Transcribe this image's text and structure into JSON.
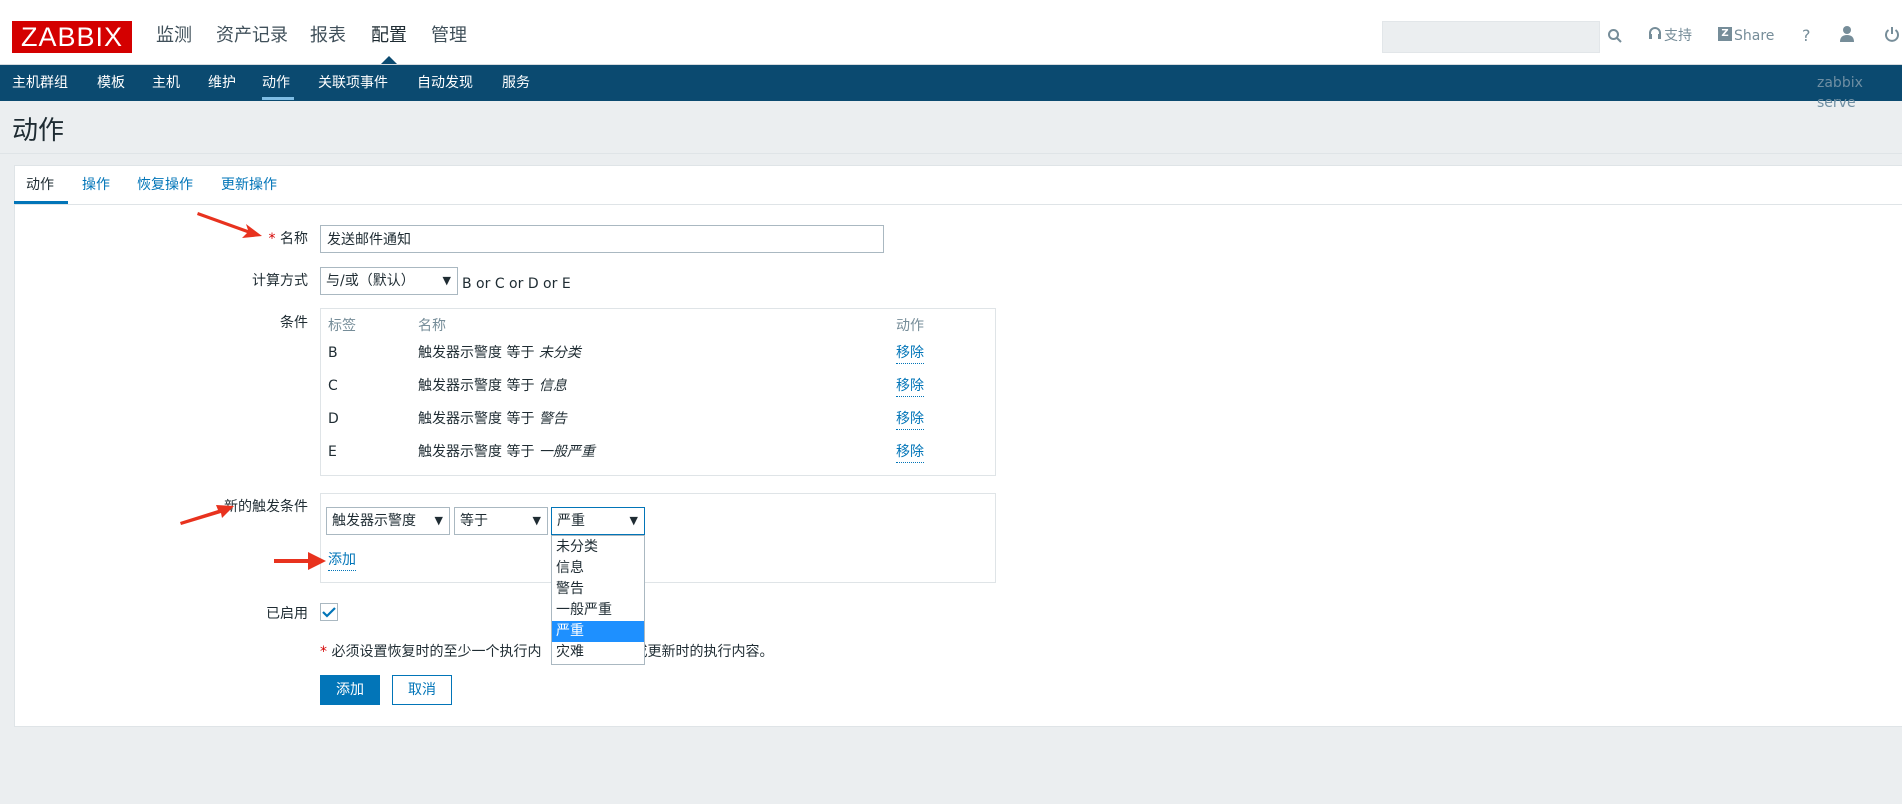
{
  "header": {
    "logo": "ZABBIX",
    "main_nav": [
      "监测",
      "资产记录",
      "报表",
      "配置",
      "管理"
    ],
    "active_main": "配置",
    "tools": {
      "support": "支持",
      "share": "Share",
      "help": "?"
    }
  },
  "sub_nav": {
    "items": [
      "主机群组",
      "模板",
      "主机",
      "维护",
      "动作",
      "关联项事件",
      "自动发现",
      "服务"
    ],
    "active": "动作",
    "server": "zabbix serve"
  },
  "page_title": "动作",
  "tabs": [
    "动作",
    "操作",
    "恢复操作",
    "更新操作"
  ],
  "form": {
    "name_label": "名称",
    "name_required": "*",
    "name_value": "发送邮件通知",
    "calc_label": "计算方式",
    "calc_value": "与/或（默认）",
    "calc_expression": "B or C or D or E",
    "conditions_label": "条件",
    "conditions_headers": [
      "标签",
      "名称",
      "动作"
    ],
    "conditions": [
      {
        "tag": "B",
        "text": "触发器示警度 等于 ",
        "value": "未分类",
        "action": "移除"
      },
      {
        "tag": "C",
        "text": "触发器示警度 等于 ",
        "value": "信息",
        "action": "移除"
      },
      {
        "tag": "D",
        "text": "触发器示警度 等于 ",
        "value": "警告",
        "action": "移除"
      },
      {
        "tag": "E",
        "text": "触发器示警度 等于 ",
        "value": "一般严重",
        "action": "移除"
      }
    ],
    "new_condition_label": "新的触发条件",
    "new_condition": {
      "type": "触发器示警度",
      "operator": "等于",
      "severity": "严重",
      "add_link": "添加",
      "severity_options": [
        "未分类",
        "信息",
        "警告",
        "一般严重",
        "严重",
        "灾难"
      ],
      "selected_option": "严重"
    },
    "enabled_label": "已启用",
    "enabled": true,
    "note_star": "*",
    "note_left": "必须设置恢复时的至少一个执行内",
    "note_right": "或更新时的执行内容。",
    "add_button": "添加",
    "cancel_button": "取消"
  },
  "colors": {
    "brand": "#d40000",
    "subnav_bg": "#0b4a70",
    "link": "#0275b8",
    "selected_option": "#1e90ff",
    "annotation_arrow": "#e8321e"
  }
}
